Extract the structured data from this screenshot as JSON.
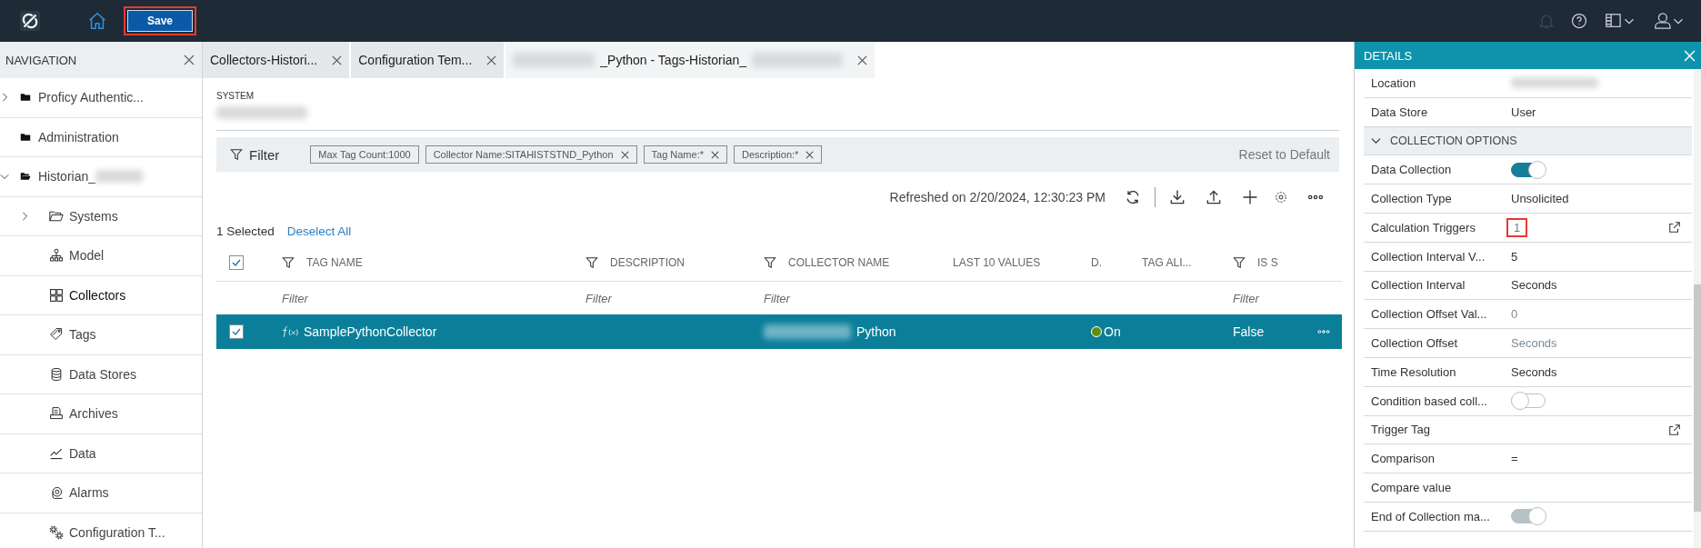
{
  "topbar": {
    "save_button": {
      "label": "Save",
      "annotated": true
    }
  },
  "navigation": {
    "title": "NAVIGATION",
    "items": [
      {
        "label": "Proficy Authentic...",
        "expanded": false,
        "selected": false
      },
      {
        "label": "Administration",
        "selected": false
      },
      {
        "label": "Historian_",
        "redacted_after": true,
        "expanded": true,
        "selected": false,
        "children": [
          {
            "label": "Systems",
            "expanded": false,
            "selected": false
          },
          {
            "label": "Model",
            "selected": false
          },
          {
            "label": "Collectors",
            "selected": true
          },
          {
            "label": "Tags",
            "selected": false
          },
          {
            "label": "Data Stores",
            "selected": false
          },
          {
            "label": "Archives",
            "selected": false
          },
          {
            "label": "Data",
            "selected": false
          },
          {
            "label": "Alarms",
            "selected": false
          },
          {
            "label": "Configuration T...",
            "selected": false
          }
        ]
      }
    ]
  },
  "tabs": [
    {
      "label": "Collectors-Histori...",
      "selected": false
    },
    {
      "label": "Configuration Tem...",
      "selected": false
    },
    {
      "label": "_Python - Tags-Historian_",
      "redacted_before": true,
      "redacted_after": true,
      "selected": true
    }
  ],
  "system": {
    "label": "SYSTEM",
    "value_redacted": true
  },
  "filter": {
    "label": "Filter",
    "chips": [
      {
        "label": "Max Tag Count:1000",
        "removable": false
      },
      {
        "label": "Collector Name:SITAHISTSTND_Python",
        "removable": true
      },
      {
        "label": "Tag Name:*",
        "removable": true
      },
      {
        "label": "Description:*",
        "removable": true
      }
    ],
    "reset": "Reset to Default"
  },
  "toolbar": {
    "refreshed": "Refreshed on 2/20/2024, 12:30:23 PM"
  },
  "selection": {
    "count": "1 Selected",
    "deselect": "Deselect All"
  },
  "table": {
    "all_checked": true,
    "columns": [
      {
        "label": "TAG NAME",
        "filterable": true,
        "filter_placeholder": "Filter"
      },
      {
        "label": "DESCRIPTION",
        "filterable": true,
        "filter_placeholder": "Filter"
      },
      {
        "label": "COLLECTOR NAME",
        "filterable": true,
        "filter_placeholder": "Filter"
      },
      {
        "label": "LAST 10 VALUES",
        "filterable": false
      },
      {
        "label": "D.",
        "filterable": false
      },
      {
        "label": "TAG ALI...",
        "filterable": false
      },
      {
        "label": "IS S",
        "filterable": true,
        "filter_placeholder": "Filter"
      }
    ],
    "rows": [
      {
        "selected": true,
        "checked": true,
        "tag_name": "SamplePythonCollector",
        "collector_name": "Python",
        "collector_redacted": true,
        "status": "On",
        "color": "#5e8f0f",
        "is_s": "False"
      }
    ]
  },
  "details": {
    "title": "DETAILS",
    "rows": [
      {
        "kind": "text",
        "label": "Location",
        "value_redacted": true
      },
      {
        "kind": "text",
        "label": "Data Store",
        "value": "User"
      },
      {
        "kind": "section",
        "label": "COLLECTION OPTIONS",
        "expanded": true
      },
      {
        "kind": "toggle",
        "label": "Data Collection",
        "on": true,
        "disabled": false
      },
      {
        "kind": "text",
        "label": "Collection Type",
        "value": "Unsolicited"
      },
      {
        "kind": "link",
        "label": "Calculation Triggers",
        "value": "1",
        "annotated": true
      },
      {
        "kind": "text",
        "label": "Collection Interval V...",
        "value": "5"
      },
      {
        "kind": "text",
        "label": "Collection Interval",
        "value": "Seconds"
      },
      {
        "kind": "text",
        "label": "Collection Offset Val...",
        "value": "0",
        "disabled": true
      },
      {
        "kind": "text",
        "label": "Collection Offset",
        "value": "Seconds",
        "disabled": true
      },
      {
        "kind": "text",
        "label": "Time Resolution",
        "value": "Seconds"
      },
      {
        "kind": "toggle",
        "label": "Condition based coll...",
        "on": false,
        "disabled": false
      },
      {
        "kind": "link",
        "label": "Trigger Tag"
      },
      {
        "kind": "text",
        "label": "Comparison",
        "value": "="
      },
      {
        "kind": "text",
        "label": "Compare value"
      },
      {
        "kind": "toggle",
        "label": "End of Collection ma...",
        "on": true,
        "disabled": true
      }
    ]
  }
}
